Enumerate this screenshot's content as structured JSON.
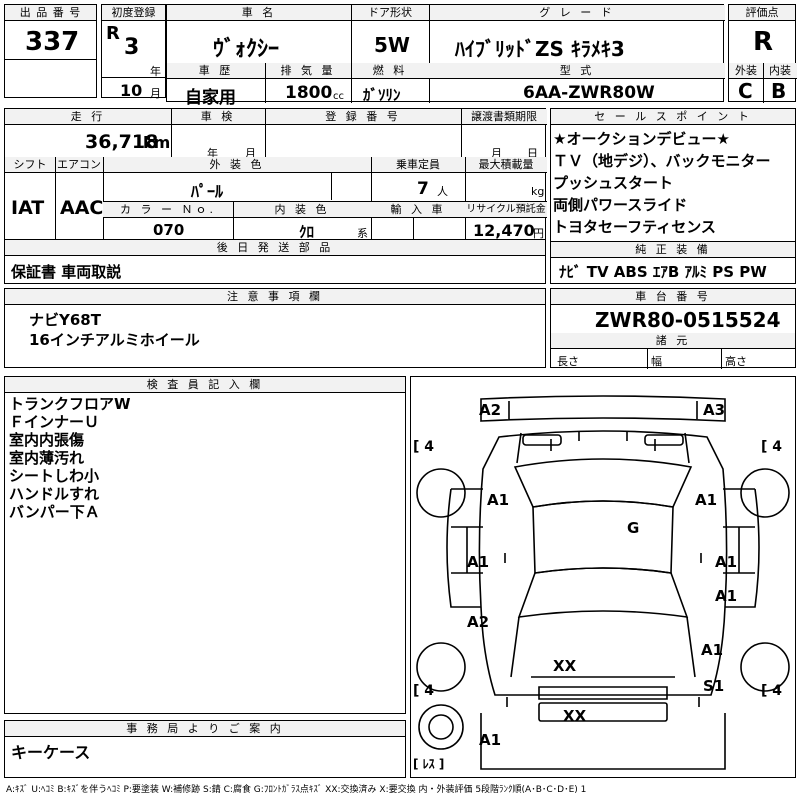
{
  "labels": {
    "lot_no": "出 品 番 号",
    "first_reg": "初度登録",
    "car_name": "車 名",
    "door": "ドア形状",
    "grade": "グ レ ー ド",
    "rating": "評価点",
    "nen": "年",
    "getsu": "月",
    "history": "車 歴",
    "displacement": "排 気 量",
    "fuel": "燃 料",
    "model": "型 式",
    "exterior": "外装",
    "interior": "内装",
    "cc": "cc",
    "mileage": "走 行",
    "inspection": "車 検",
    "registration": "登 録 番 号",
    "transfer": "譲渡書類期限",
    "sales_points": "セ ー ル ス ポ イ ン ト",
    "shift": "シフト",
    "aircon": "エアコン",
    "ext_color": "外 装 色",
    "capacity": "乗車定員",
    "max_load": "最大積載量",
    "person": "人",
    "kg": "kg",
    "color_no": "カ ラ ー Ｎｏ.",
    "int_color": "内 装 色",
    "kei": "系",
    "import": "輸 入 車",
    "recycle": "リサイクル預託金",
    "yen": "円",
    "later_parts": "後 日 発 送 部 品",
    "genuine_equipment": "純 正 装 備",
    "notes": "注 意 事 項 欄",
    "chassis_no": "車 台 番 号",
    "specs": "諸 元",
    "length": "長さ",
    "width": "幅",
    "height": "高さ",
    "inspector": "検 査 員 記 入 欄",
    "office": "事 務 局 よ り ご 案 内"
  },
  "values": {
    "lot_no": "337",
    "era": "R",
    "year": "3",
    "month": "10",
    "car_name": "ｳﾞｫｸｼｰ",
    "door": "5W",
    "grade": "ﾊｲﾌﾞﾘｯﾄﾞZS ｷﾗﾒｷ3",
    "rating": "R",
    "history": "自家用",
    "displacement": "1800",
    "fuel": "ｶﾞｿﾘﾝ",
    "model": "6AA-ZWR80W",
    "ext_score": "C",
    "int_score": "B",
    "mileage": "36,718",
    "mileage_unit": "km",
    "shift": "IAT",
    "aircon": "AAC",
    "ext_color": "ﾊﾟｰﾙ",
    "capacity": "7",
    "color_no": "070",
    "int_color": "ｸﾛ",
    "recycle": "12,470",
    "later_parts": "保証書 車両取説",
    "chassis_no": "ZWR80-0515524"
  },
  "sales_points": [
    "★オークションデビュー★",
    "ＴＶ（地デジ）、バックモニター",
    "プッシュスタート",
    "両側パワースライド",
    "トヨタセーフティセンス"
  ],
  "equipment": "ﾅﾋﾞ TV ABS ｴｱB ｱﾙﾐ PS PW",
  "notes": [
    "ナビY68T",
    "16インチアルミホイール"
  ],
  "inspector_notes": [
    "トランクフロアW",
    "ＦインナーＵ",
    "室内内張傷",
    "室内薄汚れ",
    "シートしわ小",
    "ハンドルすれ",
    "バンパー下Ａ"
  ],
  "office_note": "キーケース",
  "diagram_marks": {
    "front_left": "A2",
    "front_right": "A3",
    "tire_fl": "4",
    "tire_fr": "4",
    "tire_rl": "4",
    "tire_rr": "4",
    "fender_left": "A1",
    "fender_right": "A1",
    "roof": "G",
    "door_left_front": "A1",
    "door_right_front": "A1",
    "door_right_rear": "A1",
    "quarter_left": "A2",
    "quarter_right": "A1",
    "rear_right": "S1",
    "rear_glass": "XX",
    "rear_bumper": "XX",
    "spare": "A1",
    "spare_label": "ﾚｽ"
  },
  "legend": "A:ｷｽﾞ U:ﾍｺﾐ B:ｷｽﾞを伴うﾍｺﾐ P:要塗装 W:補修跡 S:錆 C:腐食 G:ﾌﾛﾝﾄｶﾞﾗｽ点ｷｽﾞ XX:交換済み X:要交換 内・外装評価 5段階ﾗﾝｸ順(A･B･C･D･E) 1"
}
